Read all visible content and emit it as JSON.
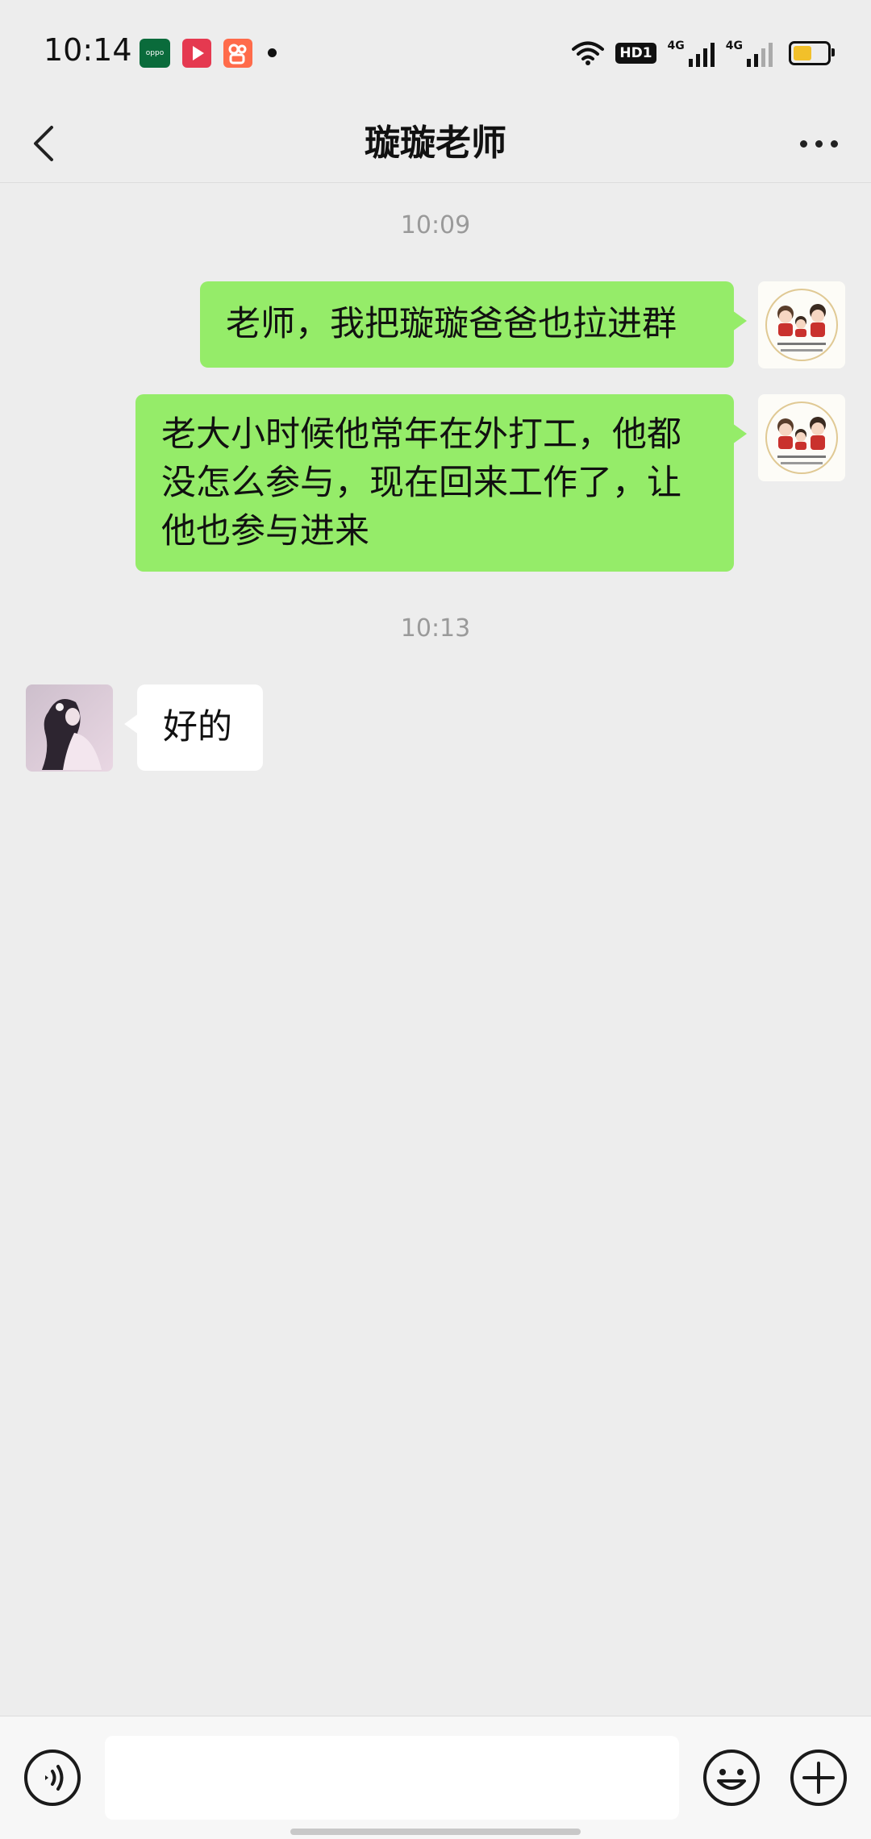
{
  "status_bar": {
    "time": "10:14",
    "hd_label": "HD1",
    "network_1": "4G",
    "network_2": "4G",
    "notification_apps": [
      "oppo-app-icon",
      "video-app-icon",
      "kuaishou-app-icon"
    ],
    "battery_level": 0.55,
    "battery_color": "#f2c02a"
  },
  "header": {
    "title": "璇璇老师",
    "back_icon": "chevron-left-icon",
    "more_icon": "more-horizontal-icon"
  },
  "messages": [
    {
      "type": "timestamp",
      "text": "10:09"
    },
    {
      "type": "message",
      "direction": "outgoing",
      "text": "老师，我把璇璇爸爸也拉进群"
    },
    {
      "type": "message",
      "direction": "outgoing",
      "text": "老大小时候他常年在外打工，他都没怎么参与，现在回来工作了，让他也参与进来"
    },
    {
      "type": "timestamp",
      "text": "10:13"
    },
    {
      "type": "message",
      "direction": "incoming",
      "text": "好的"
    }
  ],
  "input_bar": {
    "voice_icon": "voice-input-icon",
    "emoji_icon": "emoji-icon",
    "plus_icon": "plus-icon",
    "value": ""
  },
  "colors": {
    "background": "#ededed",
    "outgoing_bubble": "#95ec69",
    "incoming_bubble": "#ffffff",
    "timestamp_text": "#9a9a9a"
  }
}
